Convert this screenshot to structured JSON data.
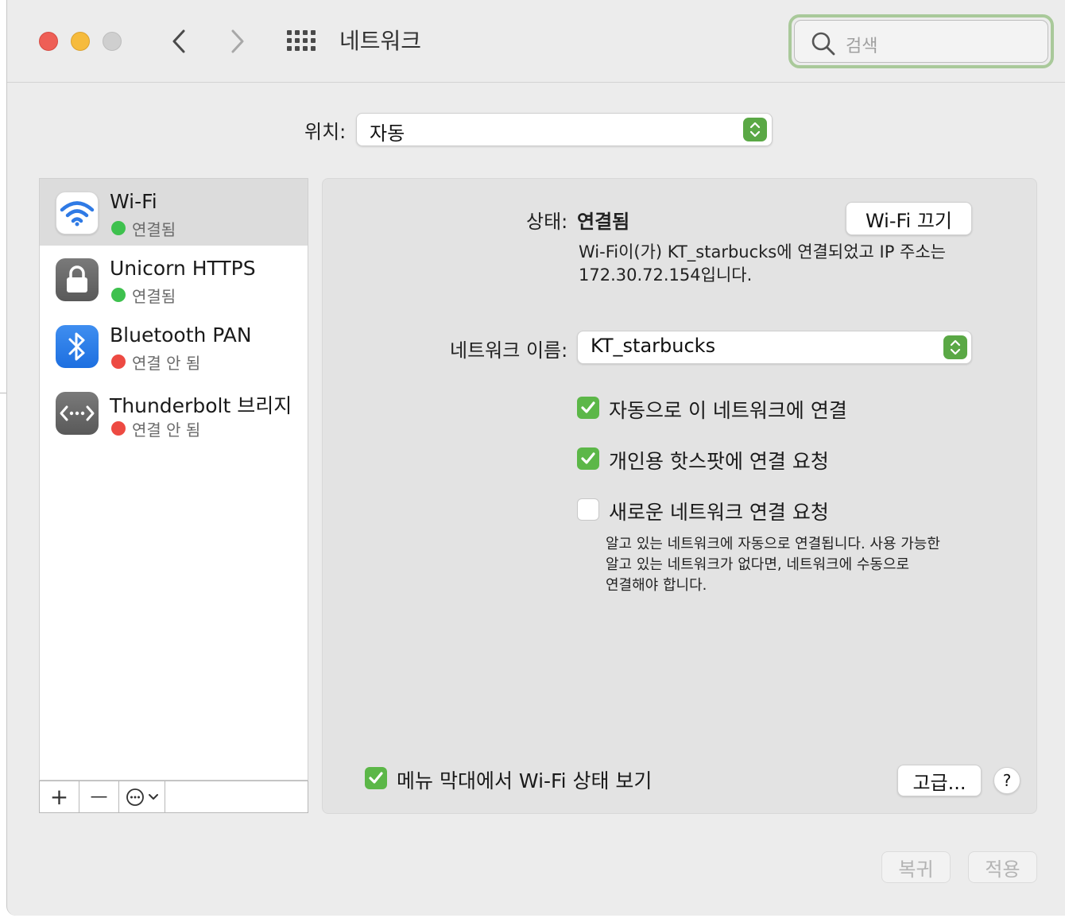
{
  "window": {
    "title": "네트워크"
  },
  "search": {
    "placeholder": "검색"
  },
  "location": {
    "label": "위치:",
    "value": "자동"
  },
  "services": [
    {
      "name": "Wi-Fi",
      "status": "연결됨",
      "status_color": "#3ec14e",
      "icon": "wifi-icon"
    },
    {
      "name": "Unicorn HTTPS",
      "status": "연결됨",
      "status_color": "#3ec14e",
      "icon": "lock-icon"
    },
    {
      "name": "Bluetooth PAN",
      "status": "연결 안 됨",
      "status_color": "#ed4a42",
      "icon": "bluetooth-icon"
    },
    {
      "name": "Thunderbolt 브리지",
      "status": "연결 안 됨",
      "status_color": "#ed4a42",
      "icon": "thunderbolt-bridge-icon"
    }
  ],
  "sidebar_toolbar": {
    "add": "+",
    "remove": "—"
  },
  "detail": {
    "status_label": "상태:",
    "status_value": "연결됨",
    "wifi_off_button": "Wi-Fi 끄기",
    "status_desc_line1": "Wi-Fi이(가) KT_starbucks에 연결되었고 IP 주소는",
    "status_desc_line2": "172.30.72.154입니다.",
    "network_name_label": "네트워크 이름:",
    "network_name_value": "KT_starbucks",
    "auto_join_label": "자동으로 이 네트워크에 연결",
    "auto_join_checked": true,
    "hotspot_label": "개인용 핫스팟에 연결 요청",
    "hotspot_checked": true,
    "ask_new_label": "새로운 네트워크 연결 요청",
    "ask_new_checked": false,
    "ask_new_desc_line1": "알고 있는 네트워크에 자동으로 연결됩니다. 사용 가능한",
    "ask_new_desc_line2": "알고 있는 네트워크가 없다면, 네트워크에 수동으로",
    "ask_new_desc_line3": "연결해야 합니다.",
    "menubar_label": "메뉴 막대에서 Wi-Fi 상태 보기",
    "menubar_checked": true,
    "advanced_button": "고급...",
    "help_button": "?"
  },
  "footer": {
    "revert": "복귀",
    "apply": "적용"
  },
  "colors": {
    "accent_green": "#5cb748",
    "focus_ring": "#a9c99a"
  }
}
